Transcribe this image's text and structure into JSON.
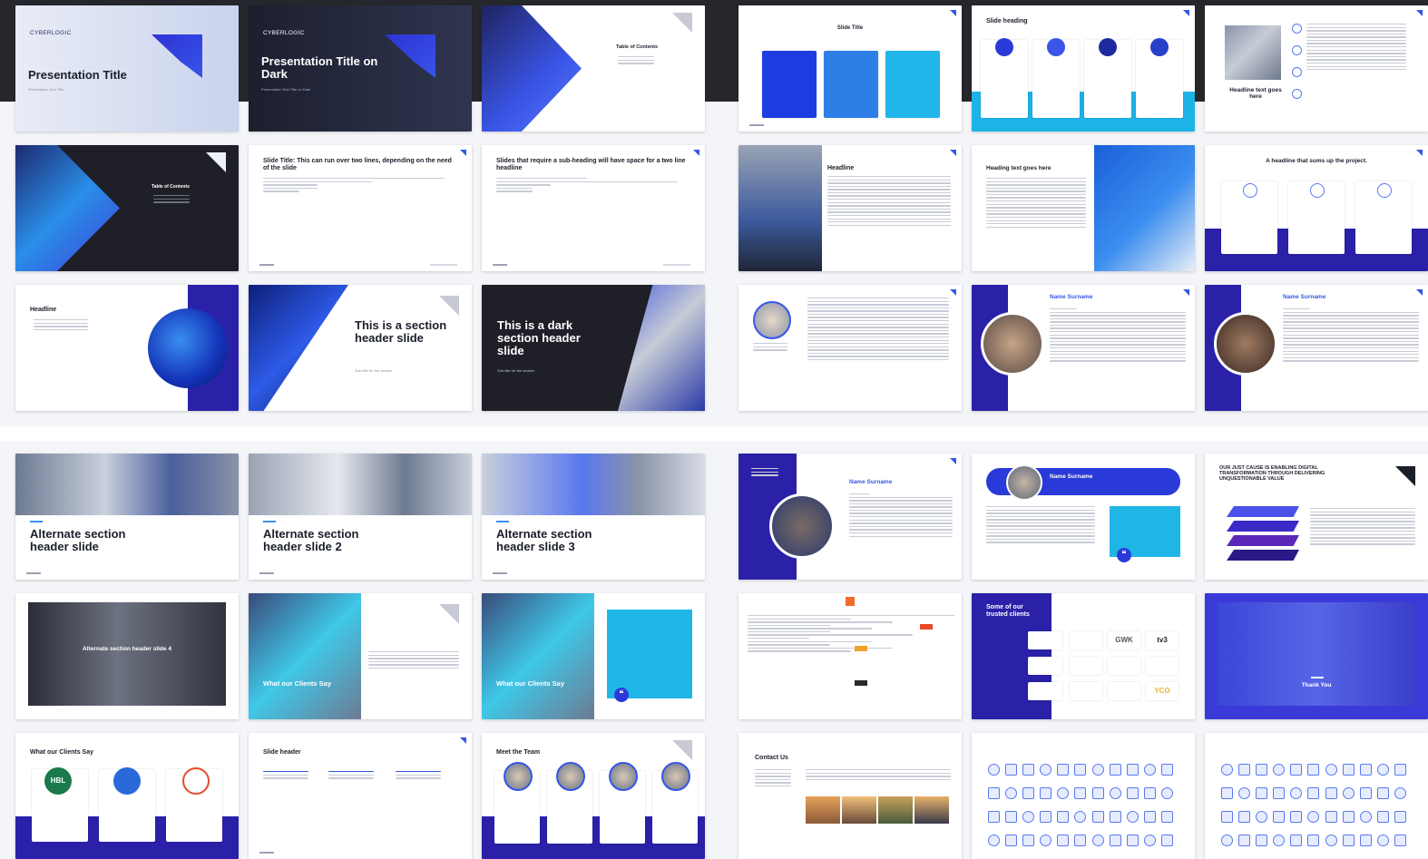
{
  "brand": {
    "name": "CYBERLOGIC",
    "accent": "#3557e6",
    "navy": "#2a21a8",
    "cyan": "#1fb6e6"
  },
  "slides": {
    "s1": {
      "title": "Presentation Title",
      "subtitle": "Presentation Sub Title"
    },
    "s2": {
      "title": "Presentation Title on Dark",
      "subtitle": "Presentation Sub Title on Dark"
    },
    "s3": {
      "title": "Table of Contents"
    },
    "s4": {
      "title": "Slide Title"
    },
    "s5": {
      "title": "Slide heading"
    },
    "s6": {
      "title": "Headline text goes here"
    },
    "s7": {
      "title": "Table of Contents"
    },
    "s8": {
      "title": "Slide Title: This can run over two lines, depending on the need of the slide"
    },
    "s9": {
      "title": "Slides that require a sub-heading will have space for a two line headline"
    },
    "s10": {
      "title": "Headline"
    },
    "s11": {
      "title": "Heading text goes here"
    },
    "s12": {
      "title": "A headline that sums up the project."
    },
    "s13": {
      "title": "Headline"
    },
    "s14": {
      "title": "This is a section header slide",
      "subtitle": "Sub-title for the section"
    },
    "s15": {
      "title": "This is a dark section header slide",
      "subtitle": "Sub-title for the section"
    },
    "s17": {
      "title": "Name Surname"
    },
    "s18": {
      "title": "Name Surname"
    },
    "s19": {
      "title": "Alternate section header slide"
    },
    "s20": {
      "title": "Alternate section header slide 2"
    },
    "s21": {
      "title": "Alternate section header slide 3"
    },
    "s22": {
      "title": "Name Surname"
    },
    "s23": {
      "title": "Name Surname"
    },
    "s24": {
      "title": "OUR JUST CAUSE IS ENABLING DIGITAL TRANSFORMATION THROUGH DELIVERING UNQUESTIONABLE VALUE"
    },
    "s25": {
      "title": "Alternate section header slide 4"
    },
    "s26": {
      "title": "What our Clients Say"
    },
    "s27": {
      "title": "What our Clients Say"
    },
    "s29": {
      "title": "Some of our trusted clients",
      "logos": [
        "GWK",
        "tv3",
        "YCO"
      ]
    },
    "s30": {
      "title": "Thank You"
    },
    "s31": {
      "title": "What our Clients Say",
      "badge": "HBL"
    },
    "s32": {
      "title": "Slide header"
    },
    "s33": {
      "title": "Meet the Team"
    },
    "s34": {
      "title": "Contact Us"
    }
  }
}
